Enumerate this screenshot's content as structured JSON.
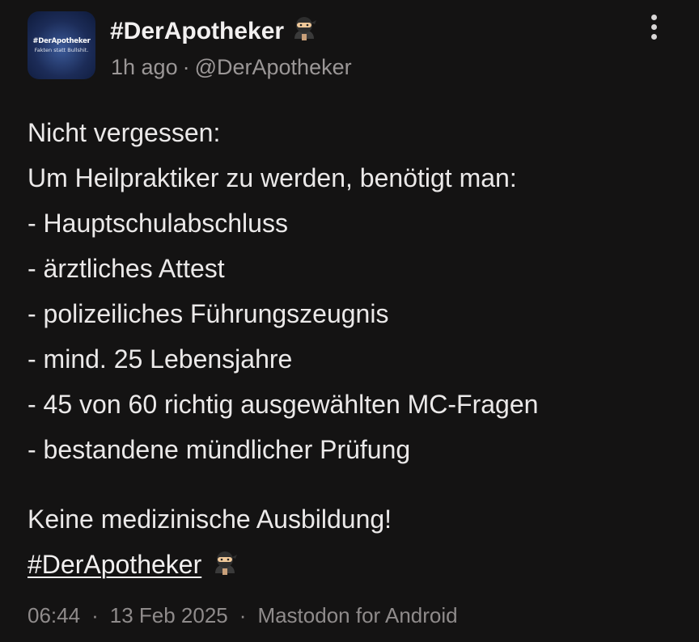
{
  "author": {
    "display_name": "#DerApotheker",
    "emoji_icon": "ninja-icon",
    "avatar": {
      "line1": "#DerApotheker",
      "line2": "Fakten statt Bullshit."
    },
    "relative_time": "1h ago",
    "separator": "·",
    "handle": "@DerApotheker"
  },
  "post": {
    "lines": [
      "Nicht vergessen:",
      "Um Heilpraktiker zu werden, benötigt man:",
      "- Hauptschulabschluss",
      "- ärztliches Attest",
      "- polizeiliches Führungszeugnis",
      "- mind. 25 Lebensjahre",
      "- 45 von 60 richtig ausgewählten MC-Fragen",
      "- bestandene mündlicher Prüfung"
    ],
    "closing": "Keine medizinische Ausbildung!",
    "hashtag": "#DerApotheker"
  },
  "footer": {
    "time": "06:44",
    "separator": "·",
    "date": "13 Feb 2025",
    "client": "Mastodon for Android"
  },
  "colors": {
    "background": "#141313",
    "text": "#ebe9e9",
    "muted": "#9b9797"
  }
}
